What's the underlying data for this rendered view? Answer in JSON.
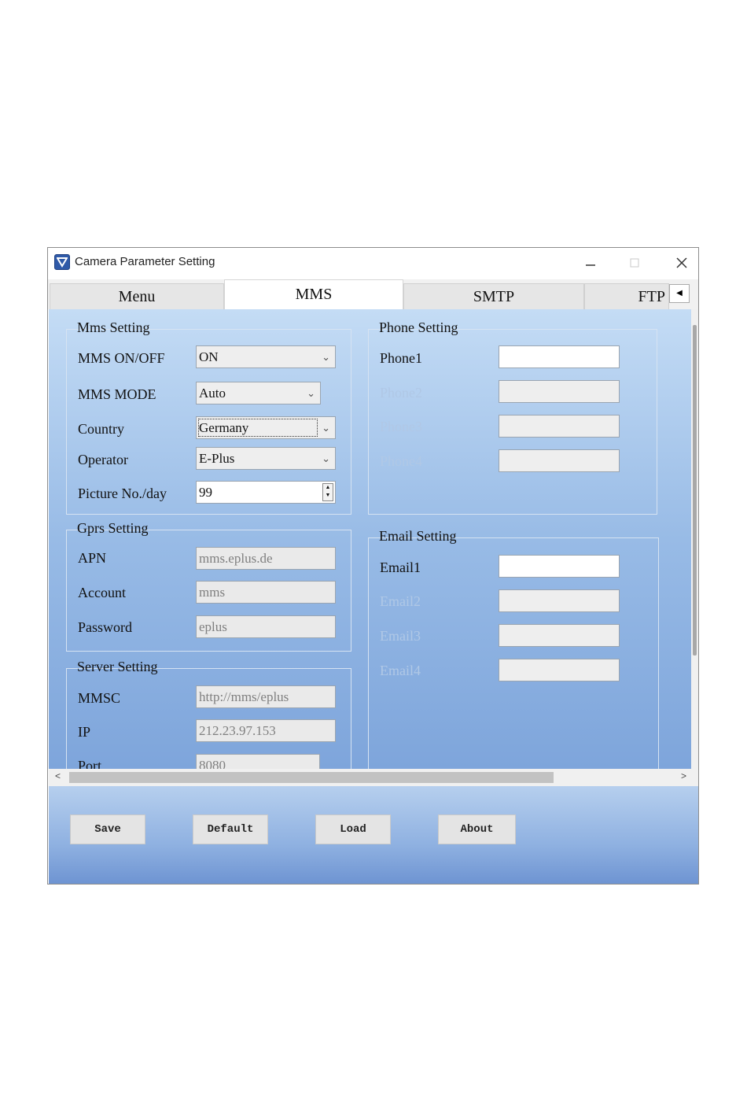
{
  "window": {
    "title": "Camera Parameter Setting"
  },
  "tabs": [
    {
      "label": "Menu"
    },
    {
      "label": "MMS"
    },
    {
      "label": "SMTP"
    },
    {
      "label": "FTP"
    }
  ],
  "mms_setting": {
    "title": "Mms Setting",
    "onoff_label": "MMS ON/OFF",
    "onoff_value": "ON",
    "mode_label": "MMS MODE",
    "mode_value": "Auto",
    "country_label": "Country",
    "country_value": "Germany",
    "operator_label": "Operator",
    "operator_value": "E-Plus",
    "picture_label": "Picture No./day",
    "picture_value": "99"
  },
  "gprs_setting": {
    "title": "Gprs Setting",
    "apn_label": "APN",
    "apn_value": "mms.eplus.de",
    "account_label": "Account",
    "account_value": "mms",
    "password_label": "Password",
    "password_value": "eplus"
  },
  "server_setting": {
    "title": "Server Setting",
    "mmsc_label": "MMSC",
    "mmsc_value": "http://mms/eplus",
    "ip_label": "IP",
    "ip_value": "212.23.97.153",
    "port_label": "Port",
    "port_value": "8080"
  },
  "phone_setting": {
    "title": "Phone Setting",
    "phones": [
      {
        "label": "Phone1",
        "value": ""
      },
      {
        "label": "Phone2",
        "value": ""
      },
      {
        "label": "Phone3",
        "value": ""
      },
      {
        "label": "Phone4",
        "value": ""
      }
    ]
  },
  "email_setting": {
    "title": "Email Setting",
    "emails": [
      {
        "label": "Email1",
        "value": ""
      },
      {
        "label": "Email2",
        "value": ""
      },
      {
        "label": "Email3",
        "value": ""
      },
      {
        "label": "Email4",
        "value": ""
      }
    ]
  },
  "buttons": {
    "save": "Save",
    "default": "Default",
    "load": "Load",
    "about": "About"
  },
  "icons": {
    "app": "camera-app-icon",
    "minimize": "minimize-icon",
    "maximize": "maximize-icon",
    "close": "close-icon",
    "dropdown": "chevron-down-icon",
    "tab_scroll": "chevron-left-icon"
  },
  "colors": {
    "panel_gradient_top": "#c4dcf5",
    "panel_gradient_bottom": "#7ea5db",
    "app_icon": "#2f5aa8"
  }
}
